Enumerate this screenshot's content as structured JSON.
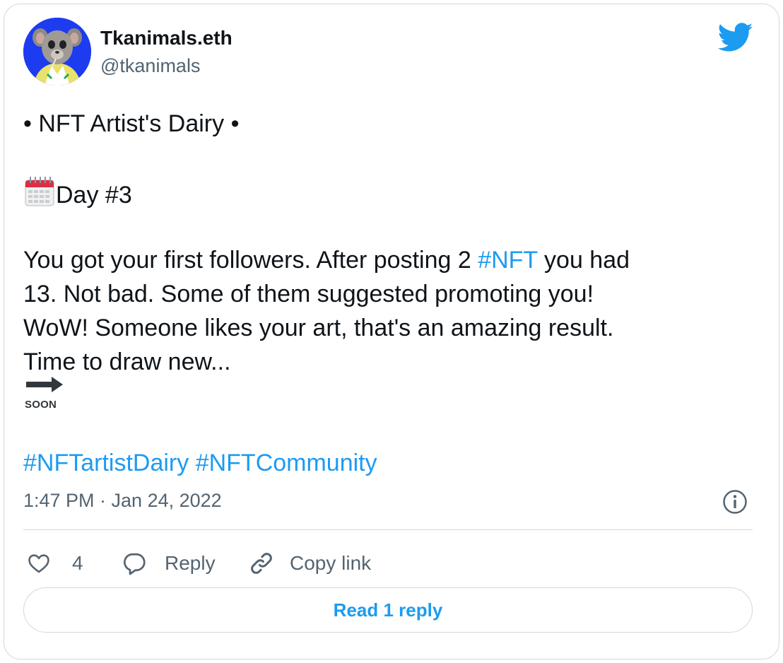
{
  "author": {
    "display_name": "Tkanimals.eth",
    "handle": "@tkanimals"
  },
  "tweet": {
    "line1": "• NFT Artist's Dairy •",
    "line2": "Day #3",
    "para_a1": "You got your first followers. After posting 2 ",
    "para_a_tag": "#NFT",
    "para_a2": " you had",
    "para_b": "13. Not bad. Some of them suggested promoting you!",
    "para_c": "WoW! Someone likes your art, that's an amazing result.",
    "para_d": "Time to draw new...",
    "soon_label": "SOON",
    "hashtag1": "#NFTartistDairy",
    "hashtag2": "#NFTCommunity",
    "timestamp": "1:47 PM · Jan 24, 2022"
  },
  "actions": {
    "like_count": "4",
    "reply_label": "Reply",
    "copy_label": "Copy link"
  },
  "read_replies_label": "Read 1 reply",
  "icons": {
    "platform": "twitter-bird-icon",
    "calendar": "spiral-calendar-icon",
    "soon": "soon-arrow-icon",
    "info": "info-icon",
    "like": "heart-icon",
    "reply": "speech-bubble-icon",
    "copy": "link-icon"
  },
  "colors": {
    "accent": "#1d9bf0",
    "text": "#0f1419",
    "secondary": "#536471",
    "border": "#cfd9de"
  }
}
